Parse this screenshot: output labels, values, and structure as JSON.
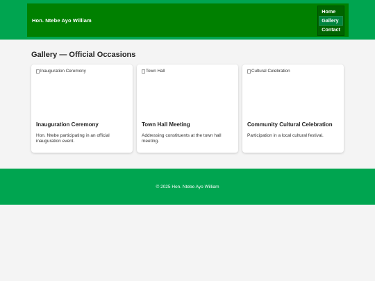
{
  "header": {
    "site_title": "Hon. Ntebe Ayo William",
    "nav": [
      {
        "label": "Home"
      },
      {
        "label": "Gallery"
      },
      {
        "label": "Contact"
      }
    ]
  },
  "main": {
    "title": "Gallery — Official Occasions",
    "cards": [
      {
        "image_alt": "Inauguration Ceremony",
        "title": "Inauguration Ceremony",
        "text": "Hon. Ntebe participating in an official inauguration event."
      },
      {
        "image_alt": "Town Hall",
        "title": "Town Hall Meeting",
        "text": "Addressing constituents at the town hall meeting."
      },
      {
        "image_alt": "Cultural Celebration",
        "title": "Community Cultural Celebration",
        "text": "Participation in a local cultural festival."
      }
    ]
  },
  "footer": {
    "text": "© 2025 Hon. Ntebe Ayo William"
  },
  "colors": {
    "brand_green": "#00a550",
    "header_green": "#008000",
    "nav_green": "#006400"
  }
}
